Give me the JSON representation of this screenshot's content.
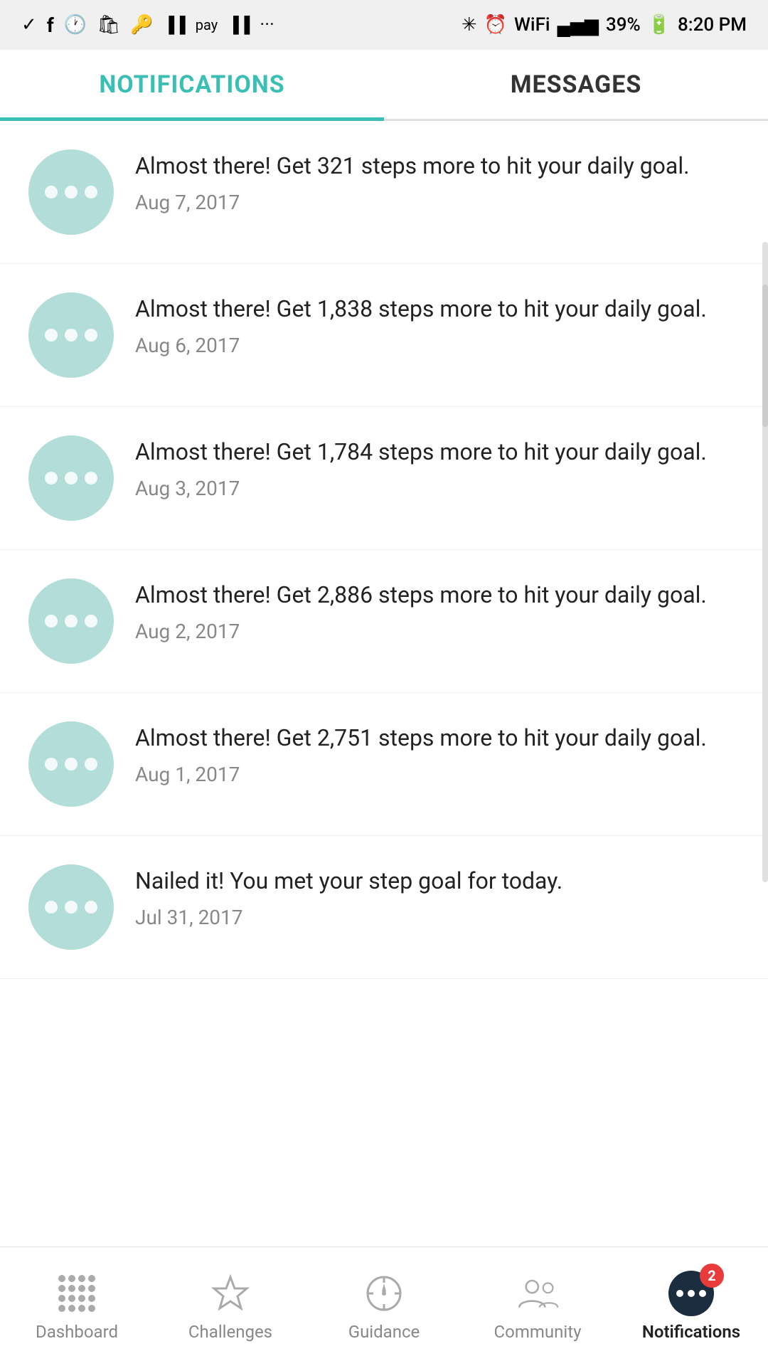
{
  "statusBar": {
    "battery": "39%",
    "time": "8:20 PM",
    "signal": "●●●"
  },
  "tabs": [
    {
      "id": "notifications",
      "label": "NOTIFICATIONS",
      "active": true
    },
    {
      "id": "messages",
      "label": "MESSAGES",
      "active": false
    }
  ],
  "notifications": [
    {
      "id": 1,
      "message": "Almost there! Get 321 steps more to hit your daily goal.",
      "date": "Aug 7, 2017"
    },
    {
      "id": 2,
      "message": "Almost there! Get 1,838 steps more to hit your daily goal.",
      "date": "Aug 6, 2017"
    },
    {
      "id": 3,
      "message": "Almost there! Get 1,784 steps more to hit your daily goal.",
      "date": "Aug 3, 2017"
    },
    {
      "id": 4,
      "message": "Almost there! Get 2,886 steps more to hit your daily goal.",
      "date": "Aug 2, 2017"
    },
    {
      "id": 5,
      "message": "Almost there! Get 2,751 steps more to hit your daily goal.",
      "date": "Aug 1, 2017"
    },
    {
      "id": 6,
      "message": "Nailed it! You met your step goal for today.",
      "date": "Jul 31, 2017"
    }
  ],
  "bottomNav": {
    "items": [
      {
        "id": "dashboard",
        "label": "Dashboard",
        "active": false
      },
      {
        "id": "challenges",
        "label": "Challenges",
        "active": false
      },
      {
        "id": "guidance",
        "label": "Guidance",
        "active": false
      },
      {
        "id": "community",
        "label": "Community",
        "active": false
      },
      {
        "id": "notifications",
        "label": "Notifications",
        "active": true
      }
    ],
    "badge": "2"
  }
}
